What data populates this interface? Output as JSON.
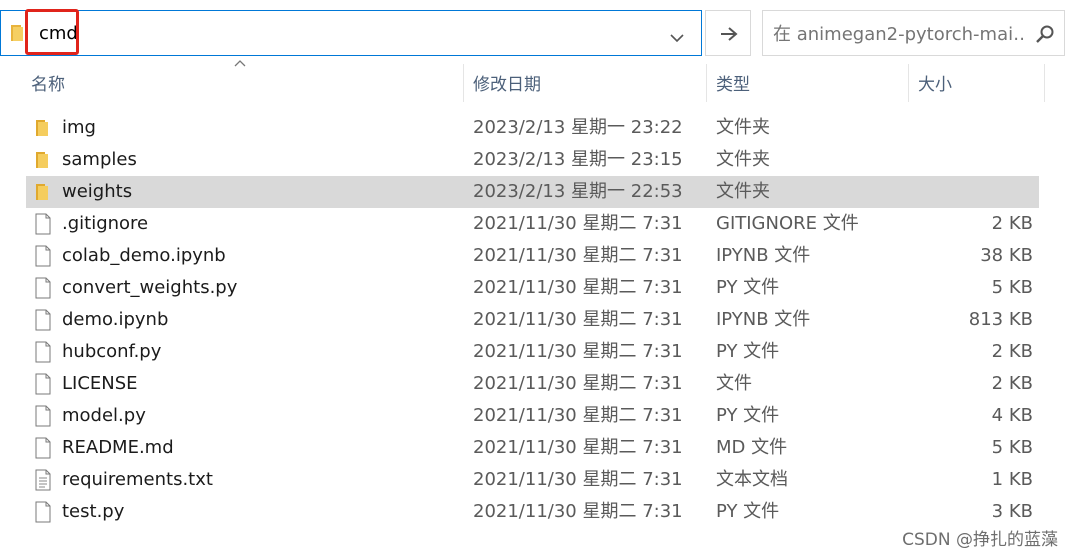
{
  "address_bar": {
    "value": "cmd"
  },
  "search": {
    "placeholder": "在 animegan2-pytorch-mai…"
  },
  "columns": {
    "name": "名称",
    "date": "修改日期",
    "type": "类型",
    "size": "大小"
  },
  "files": [
    {
      "name": "img",
      "date": "2023/2/13 星期一 23:22",
      "type": "文件夹",
      "size": "",
      "icon": "folder-icon",
      "selected": false
    },
    {
      "name": "samples",
      "date": "2023/2/13 星期一 23:15",
      "type": "文件夹",
      "size": "",
      "icon": "folder-icon",
      "selected": false
    },
    {
      "name": "weights",
      "date": "2023/2/13 星期一 22:53",
      "type": "文件夹",
      "size": "",
      "icon": "folder-icon",
      "selected": true
    },
    {
      "name": ".gitignore",
      "date": "2021/11/30 星期二 7:31",
      "type": "GITIGNORE 文件",
      "size": "2 KB",
      "icon": "file-icon",
      "selected": false
    },
    {
      "name": "colab_demo.ipynb",
      "date": "2021/11/30 星期二 7:31",
      "type": "IPYNB 文件",
      "size": "38 KB",
      "icon": "file-icon",
      "selected": false
    },
    {
      "name": "convert_weights.py",
      "date": "2021/11/30 星期二 7:31",
      "type": "PY 文件",
      "size": "5 KB",
      "icon": "file-icon",
      "selected": false
    },
    {
      "name": "demo.ipynb",
      "date": "2021/11/30 星期二 7:31",
      "type": "IPYNB 文件",
      "size": "813 KB",
      "icon": "file-icon",
      "selected": false
    },
    {
      "name": "hubconf.py",
      "date": "2021/11/30 星期二 7:31",
      "type": "PY 文件",
      "size": "2 KB",
      "icon": "file-icon",
      "selected": false
    },
    {
      "name": "LICENSE",
      "date": "2021/11/30 星期二 7:31",
      "type": "文件",
      "size": "2 KB",
      "icon": "file-icon",
      "selected": false
    },
    {
      "name": "model.py",
      "date": "2021/11/30 星期二 7:31",
      "type": "PY 文件",
      "size": "4 KB",
      "icon": "file-icon",
      "selected": false
    },
    {
      "name": "README.md",
      "date": "2021/11/30 星期二 7:31",
      "type": "MD 文件",
      "size": "5 KB",
      "icon": "file-icon",
      "selected": false
    },
    {
      "name": "requirements.txt",
      "date": "2021/11/30 星期二 7:31",
      "type": "文本文档",
      "size": "1 KB",
      "icon": "text-file-icon",
      "selected": false
    },
    {
      "name": "test.py",
      "date": "2021/11/30 星期二 7:31",
      "type": "PY 文件",
      "size": "3 KB",
      "icon": "file-icon",
      "selected": false
    }
  ],
  "watermark": "CSDN @挣扎的蓝藻",
  "colors": {
    "accent": "#0078d7",
    "highlight_box": "#e0241b",
    "selected_row": "#d9d9d9",
    "folder": "#f2c244"
  }
}
